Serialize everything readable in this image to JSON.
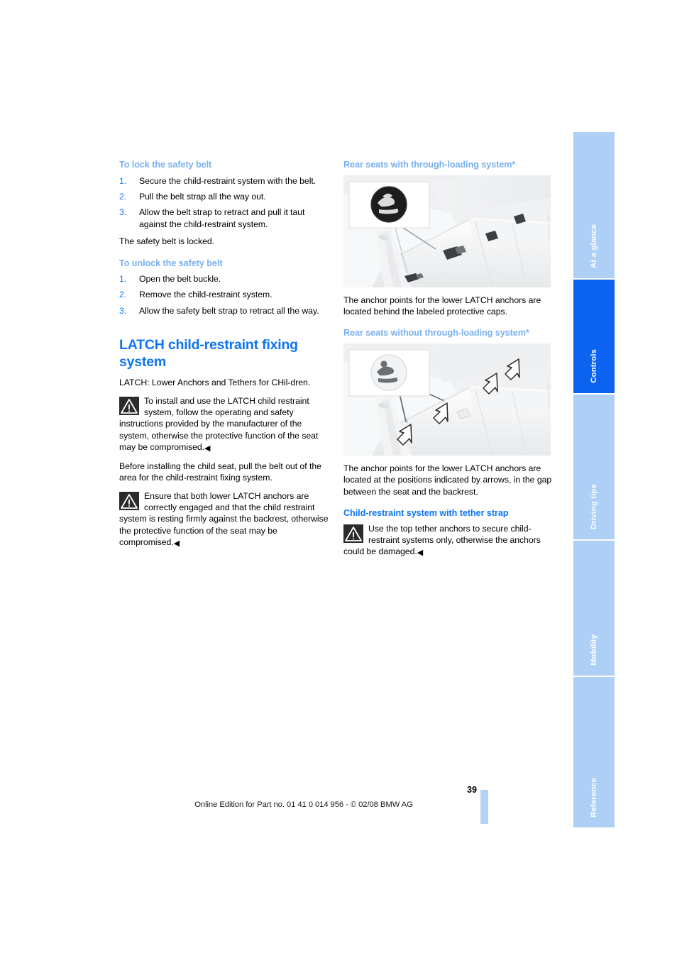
{
  "document": {
    "page_number": "39",
    "footer_note": "Online Edition for Part no. 01 41 0 014 956 - © 02/08 BMW AG"
  },
  "left_column": {
    "lock_section": {
      "heading": "To lock the safety belt",
      "steps": [
        {
          "num": "1.",
          "text": "Secure the child-restraint system with the belt."
        },
        {
          "num": "2.",
          "text": "Pull the belt strap all the way out."
        },
        {
          "num": "3.",
          "text": "Allow the belt strap to retract and pull it taut against the child-restraint system."
        }
      ],
      "closing": "The safety belt is locked."
    },
    "unlock_section": {
      "heading": "To unlock the safety belt",
      "steps": [
        {
          "num": "1.",
          "text": "Open the belt buckle."
        },
        {
          "num": "2.",
          "text": "Remove the child-restraint system."
        },
        {
          "num": "3.",
          "text": "Allow the safety belt strap to retract all the way."
        }
      ]
    },
    "latch_section": {
      "heading": "LATCH child-restraint fixing system",
      "definition": "LATCH: Lower Anchors and Tethers for CHil-dren.",
      "warning_one": "To install and use the LATCH child restraint system, follow the operating and safety instructions provided by the manufacturer of the system, otherwise the protective function of the seat may be compromised.",
      "note": "Before installing the child seat, pull the belt out of the area for the child-restraint fixing system.",
      "warning_two": "Ensure that both lower LATCH anchors are correctly engaged and that the child restraint system is resting firmly against the backrest, otherwise the protective function of the seat may be compromised.",
      "warning_end_marker": "◀"
    }
  },
  "right_column": {
    "with_through_loading": {
      "heading": "Rear seats with through-loading system*",
      "figure_name": "rear-seats-with-through-loading-figure",
      "figure_code": "WTCHGHDVA",
      "caption": "The anchor points for the lower LATCH anchors are located behind the labeled protective caps."
    },
    "without_through_loading": {
      "heading": "Rear seats without through-loading system*",
      "figure_name": "rear-seats-without-through-loading-figure",
      "figure_code": "WTCHGHDAA",
      "caption": "The anchor points for the lower LATCH anchors are located at the positions indicated by arrows, in the gap between the seat and the backrest."
    },
    "tether_section": {
      "heading": "Child-restraint system with tether strap",
      "warning": "Use the top tether anchors to secure child-restraint systems only, otherwise the anchors could be damaged.",
      "warning_end_marker": "◀"
    }
  },
  "side_tabs": [
    {
      "label": "At a glance",
      "active": false
    },
    {
      "label": "Controls",
      "active": true
    },
    {
      "label": "Driving tips",
      "active": false
    },
    {
      "label": "Mobility",
      "active": false
    },
    {
      "label": "Reference",
      "active": false
    }
  ],
  "colors": {
    "accent_blue": "#0d74f7",
    "light_blue": "#78b0ef",
    "tab_inactive": "#aed0f7",
    "tab_active": "#0b63f0"
  }
}
